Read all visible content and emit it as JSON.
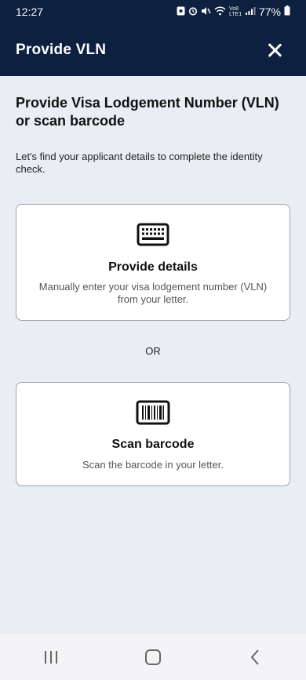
{
  "status_bar": {
    "time": "12:27",
    "battery": "77%",
    "icons": [
      "sim-icon",
      "alarm-icon",
      "mute-icon",
      "wifi-icon",
      "volte-icon",
      "signal-icon",
      "battery-icon"
    ],
    "lte_label": "Vo8 LTE1"
  },
  "app_bar": {
    "title": "Provide VLN",
    "close_icon": "close-icon"
  },
  "main": {
    "heading": "Provide Visa Lodgement Number (VLN) or scan barcode",
    "subtext": "Let's find your applicant details to complete the identity check.",
    "options": [
      {
        "icon": "keyboard-icon",
        "title": "Provide details",
        "description": "Manually enter your visa lodgement number (VLN) from your letter."
      },
      {
        "icon": "barcode-icon",
        "title": "Scan barcode",
        "description": "Scan the barcode in your letter."
      }
    ],
    "separator": "OR"
  },
  "nav_bar": {
    "buttons": [
      "recent-apps-icon",
      "home-icon",
      "back-icon"
    ]
  },
  "colors": {
    "header_bg": "#0e2040",
    "page_bg": "#e8eef3",
    "card_border": "#9aa3ab"
  }
}
